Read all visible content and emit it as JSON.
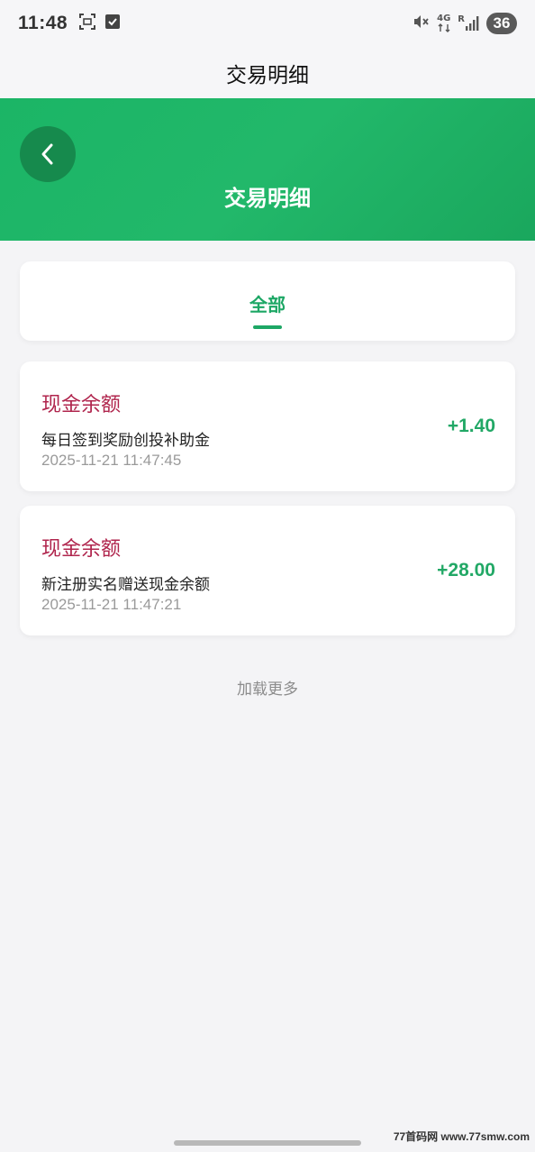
{
  "status_bar": {
    "time": "11:48",
    "network": "4G",
    "signal_label": "R",
    "battery": "36"
  },
  "title_bar": {
    "title": "交易明细"
  },
  "header": {
    "title": "交易明细"
  },
  "tabs": [
    {
      "label": "全部",
      "active": true
    }
  ],
  "transactions": [
    {
      "type": "现金余额",
      "description": "每日签到奖励创投补助金",
      "time": "2025-11-21 11:47:45",
      "amount": "+1.40"
    },
    {
      "type": "现金余额",
      "description": "新注册实名赠送现金余额",
      "time": "2025-11-21 11:47:21",
      "amount": "+28.00"
    }
  ],
  "load_more": "加载更多",
  "watermark": "77首码网 www.77smw.com",
  "colors": {
    "brand_green": "#1bb566",
    "type_red": "#b0254d",
    "amount_green": "#22a866"
  }
}
